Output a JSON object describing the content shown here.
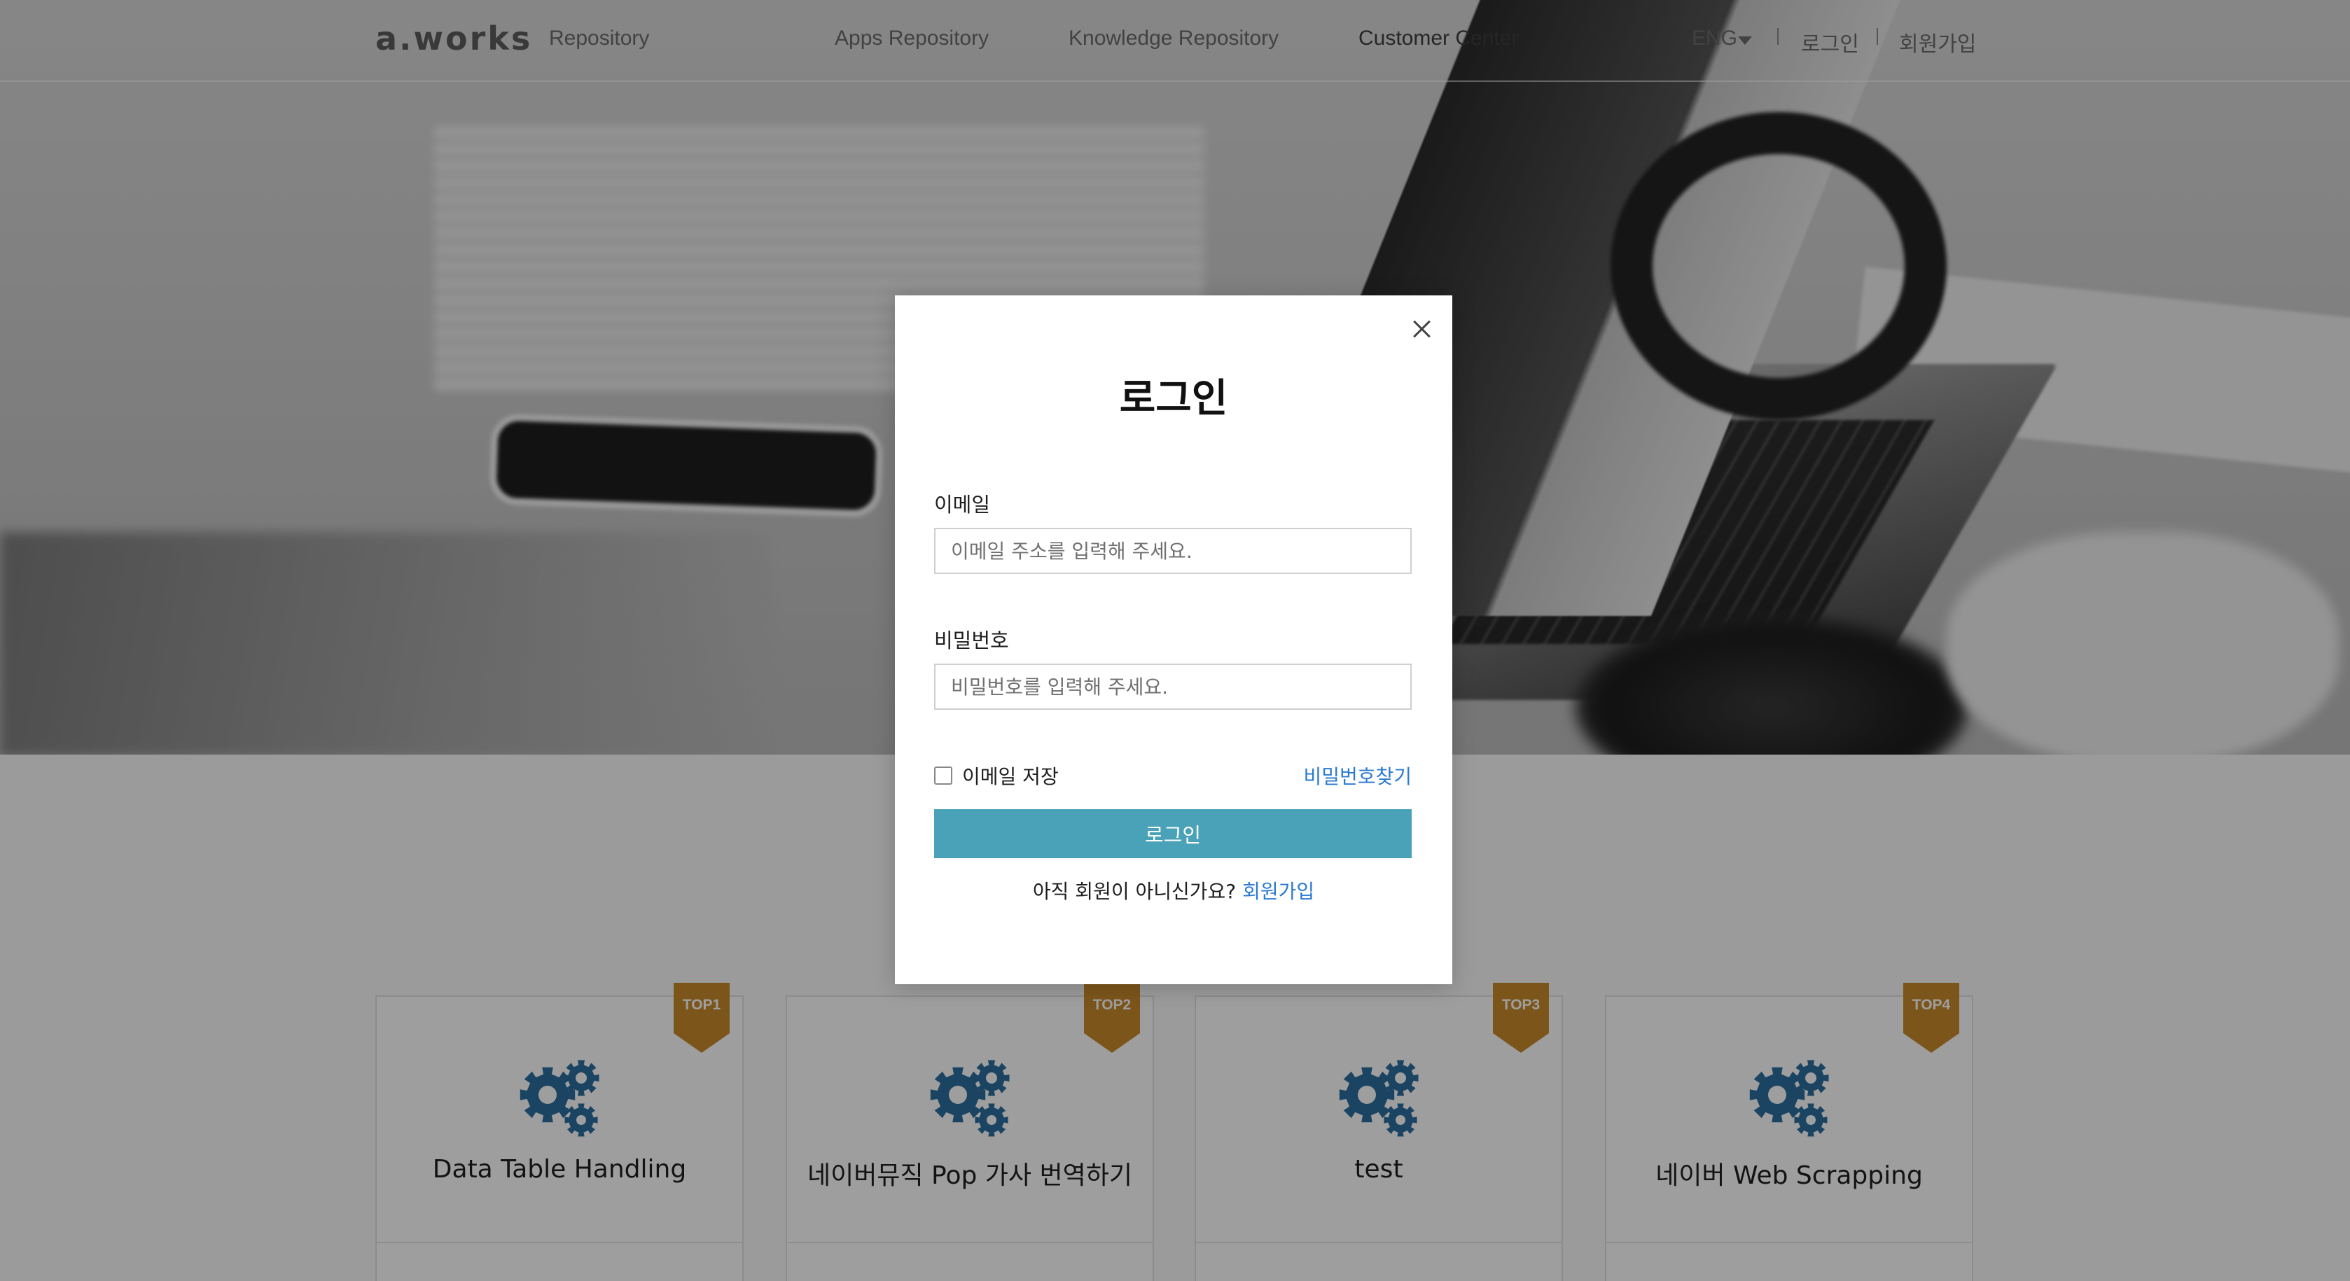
{
  "header": {
    "logo": "a.works",
    "logo_sub": "Repository",
    "nav": [
      "Apps Repository",
      "Knowledge Repository",
      "Customer Center"
    ],
    "language": "ENG",
    "login": "로그인",
    "signup": "회원가입"
  },
  "cards": [
    {
      "badge": "TOP1",
      "title": "Data Table Handling"
    },
    {
      "badge": "TOP2",
      "title": "네이버뮤직 Pop 가사 번역하기"
    },
    {
      "badge": "TOP3",
      "title": "test"
    },
    {
      "badge": "TOP4",
      "title": "네이버 Web Scrapping"
    }
  ],
  "modal": {
    "title": "로그인",
    "email_label": "이메일",
    "email_placeholder": "이메일 주소를 입력해 주세요.",
    "password_label": "비밀번호",
    "password_placeholder": "비밀번호를 입력해 주세요.",
    "remember_label": "이메일 저장",
    "find_password": "비밀번호찾기",
    "login_button": "로그인",
    "signup_prompt": "아직 회원이 아니신가요?",
    "signup_link": "회원가입"
  },
  "colors": {
    "primary_button": "#49a2b7",
    "link": "#2a7ad0",
    "badge": "#c8892c",
    "gear_icon": "#2b6f9e"
  }
}
